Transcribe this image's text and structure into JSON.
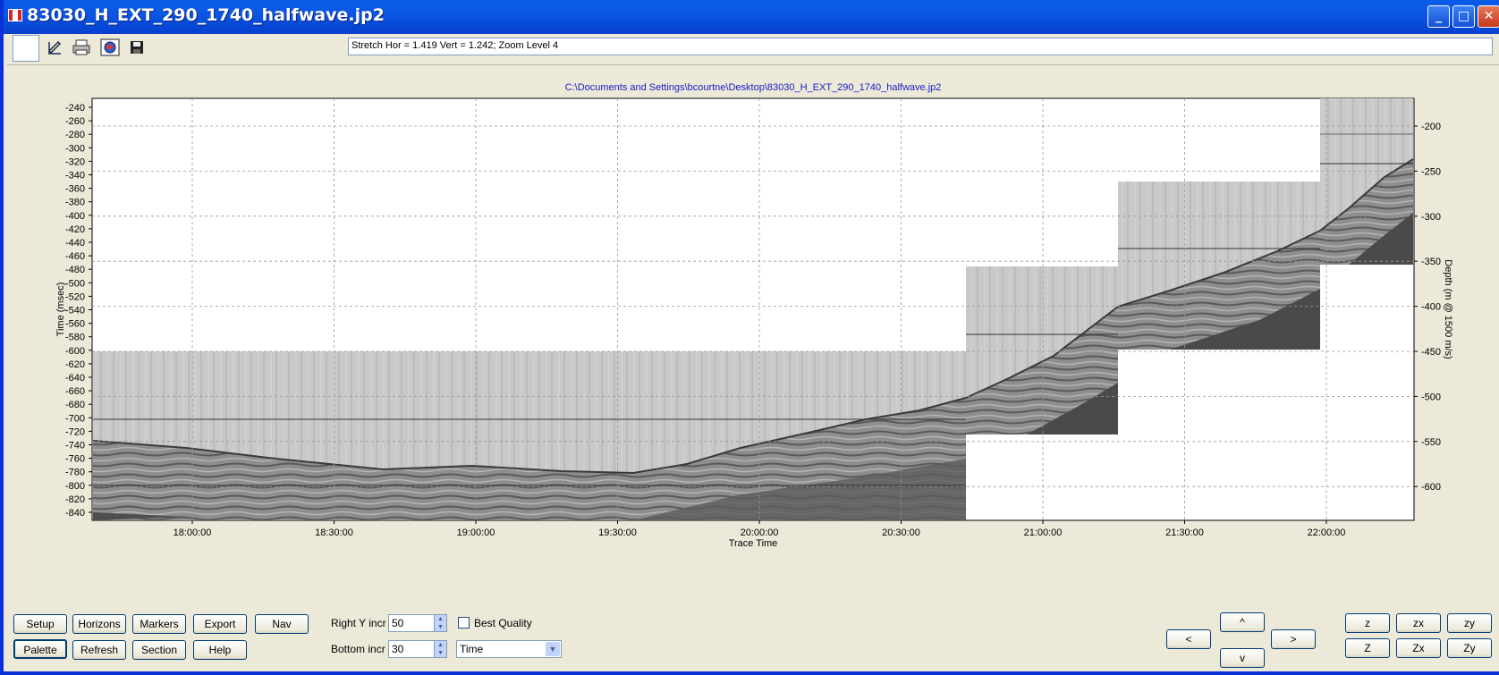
{
  "window": {
    "title": "83030_H_EXT_290_1740_halfwave.jp2",
    "minimize_glyph": "_",
    "maximize_glyph": "□",
    "close_glyph": "✕"
  },
  "toolbar": {
    "icons": [
      "edit-icon",
      "print-icon",
      "globe-icon",
      "save-icon"
    ],
    "status": "Stretch Hor = 1.419 Vert = 1.242; Zoom Level 4"
  },
  "plot": {
    "file_path": "C:\\Documents and Settings\\bcourtne\\Desktop\\83030_H_EXT_290_1740_halfwave.jp2",
    "left_axis_label": "Time (msec)",
    "right_axis_label": "Depth (m @ 1500 m/s)",
    "bottom_axis_label": "Trace Time",
    "left_ticks": [
      "-240",
      "-260",
      "-280",
      "-300",
      "-320",
      "-340",
      "-360",
      "-380",
      "-400",
      "-420",
      "-440",
      "-460",
      "-480",
      "-500",
      "-520",
      "-540",
      "-560",
      "-580",
      "-600",
      "-620",
      "-640",
      "-660",
      "-680",
      "-700",
      "-720",
      "-740",
      "-760",
      "-780",
      "-800",
      "-820",
      "-840"
    ],
    "right_ticks": [
      "-200",
      "-250",
      "-300",
      "-350",
      "-400",
      "-450",
      "-500",
      "-550",
      "-600"
    ],
    "bottom_ticks": [
      "18:00:00",
      "18:30:00",
      "19:00:00",
      "19:30:00",
      "20:00:00",
      "20:30:00",
      "21:00:00",
      "21:30:00",
      "22:00:00"
    ]
  },
  "controls": {
    "setup": "Setup",
    "horizons": "Horizons",
    "markers": "Markers",
    "export": "Export",
    "nav": "Nav",
    "palette": "Palette",
    "refresh": "Refresh",
    "section": "Section",
    "help": "Help",
    "right_y_incr_label": "Right Y incr",
    "right_y_incr_value": "50",
    "bottom_incr_label": "Bottom  incr",
    "bottom_incr_value": "30",
    "best_quality_label": "Best Quality",
    "axis_mode_value": "Time",
    "nav_up": "^",
    "nav_down": "v",
    "nav_left": "<",
    "nav_right": ">",
    "z": "z",
    "zx": "zx",
    "zy": "zy",
    "Z": "Z",
    "Zx": "Zx",
    "Zy": "Zy"
  }
}
